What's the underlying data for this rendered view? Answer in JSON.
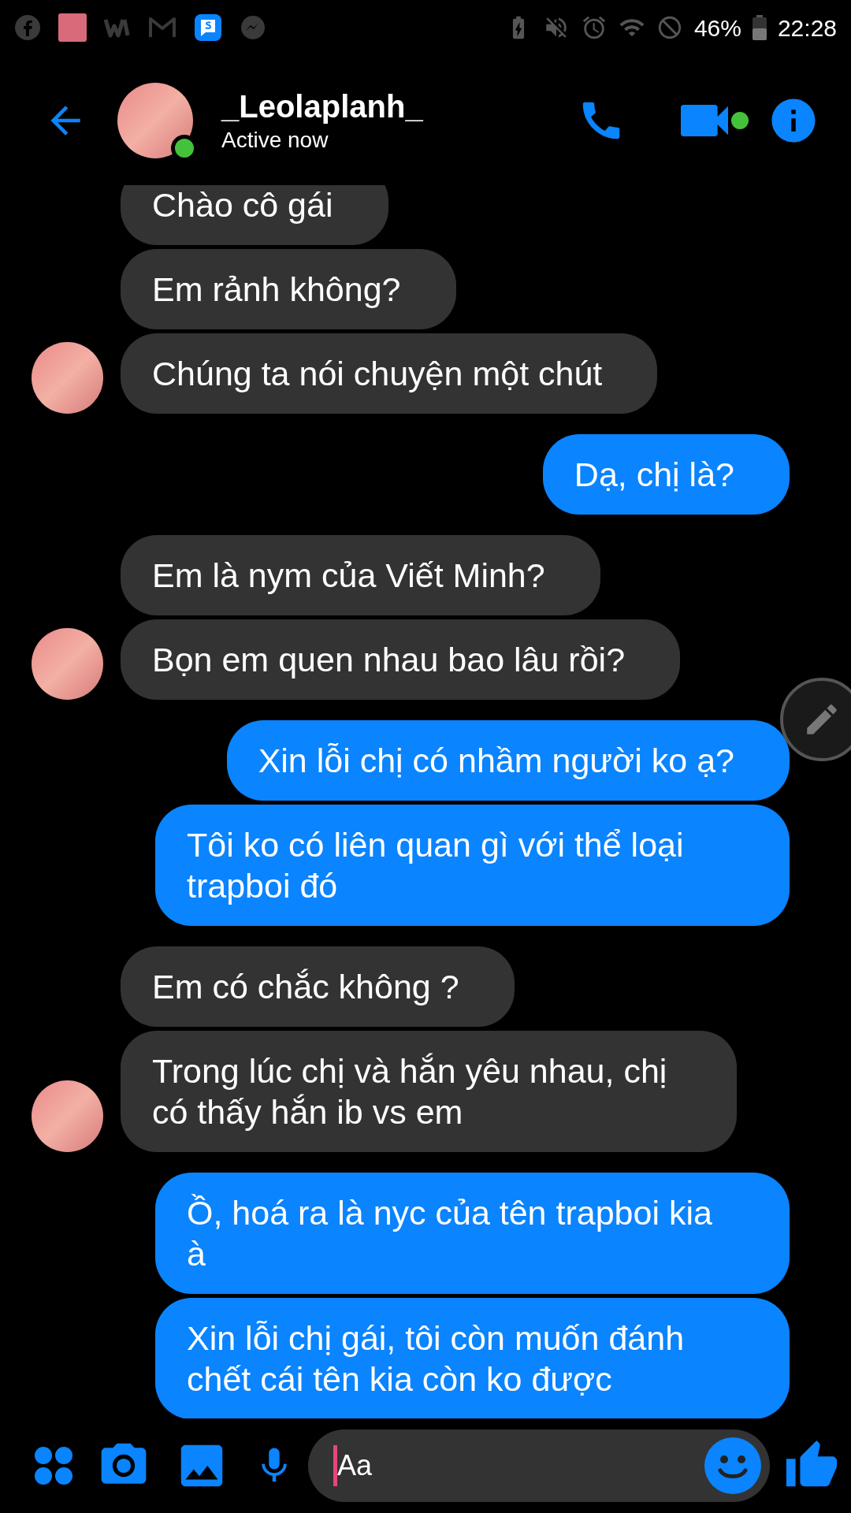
{
  "status_bar": {
    "battery": "46%",
    "time": "22:28"
  },
  "header": {
    "name": "_Leolaplanh_",
    "status": "Active now",
    "online": true
  },
  "messages": [
    {
      "kind": "received",
      "text": "Chào cô gái",
      "avatar": false
    },
    {
      "kind": "received",
      "text": "Em rảnh không?",
      "avatar": false
    },
    {
      "kind": "received",
      "text": "Chúng ta nói chuyện một chút",
      "avatar": true
    },
    {
      "kind": "sent",
      "text": "Dạ, chị là?",
      "avatar": false
    },
    {
      "kind": "received",
      "text": "Em là nym của Viết Minh?",
      "avatar": false
    },
    {
      "kind": "received",
      "text": "Bọn em quen nhau bao lâu rồi?",
      "avatar": true
    },
    {
      "kind": "sent",
      "text": "Xin lỗi chị có nhầm người ko ạ?",
      "avatar": false
    },
    {
      "kind": "sent",
      "text": "Tôi ko có liên quan gì với thể loại trapboi đó",
      "avatar": false
    },
    {
      "kind": "received",
      "text": "Em có chắc không ?",
      "avatar": false
    },
    {
      "kind": "received",
      "text": "Trong lúc chị và hắn yêu nhau, chị có thấy hắn ib vs em",
      "avatar": true
    },
    {
      "kind": "sent",
      "text": "Ồ, hoá ra là nyc của tên trapboi kia à",
      "avatar": false
    },
    {
      "kind": "sent",
      "text": "Xin lỗi chị gái, tôi còn muốn đánh chết cái tên kia còn ko được",
      "avatar": false
    }
  ],
  "composer": {
    "placeholder": "Aa"
  }
}
